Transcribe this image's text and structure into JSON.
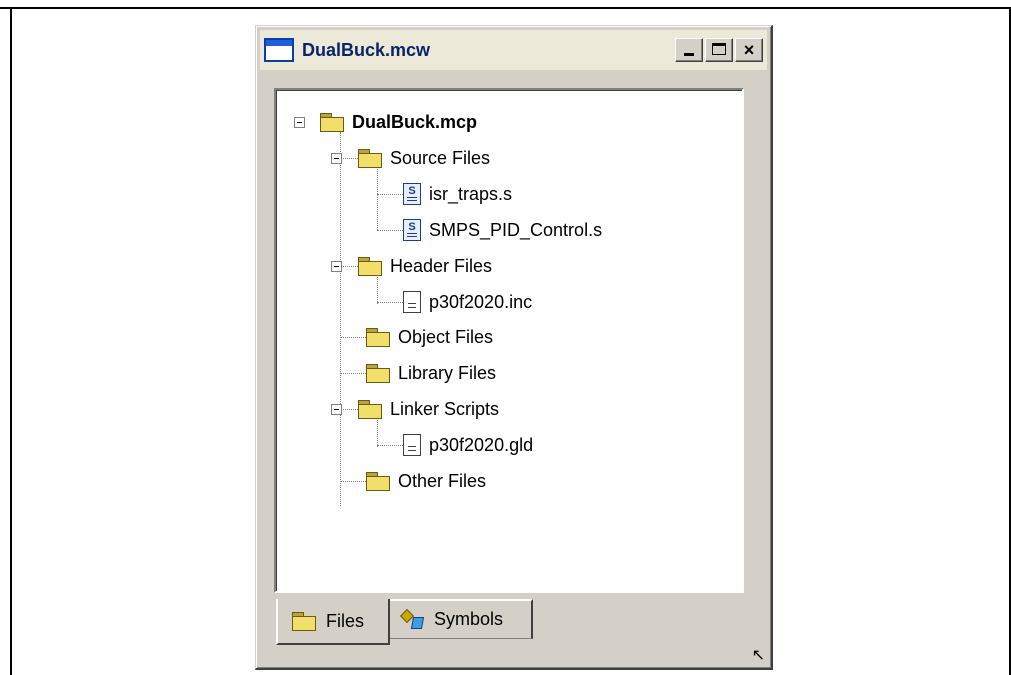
{
  "window": {
    "title": "DualBuck.mcw",
    "controls": {
      "minimize": "minimize",
      "maximize": "maximize",
      "close": "×"
    }
  },
  "tree": {
    "root": {
      "label": "DualBuck.mcp",
      "icon": "folder-icon"
    },
    "groups": [
      {
        "label": "Source Files",
        "children": [
          "isr_traps.s",
          "SMPS_PID_Control.s"
        ]
      },
      {
        "label": "Header Files",
        "children": [
          "p30f2020.inc"
        ]
      },
      {
        "label": "Object Files",
        "children": []
      },
      {
        "label": "Library Files",
        "children": []
      },
      {
        "label": "Linker Scripts",
        "children": [
          "p30f2020.gld"
        ]
      },
      {
        "label": "Other Files",
        "children": []
      }
    ]
  },
  "tabs": [
    {
      "label": "Files",
      "icon": "folder-icon",
      "selected": true
    },
    {
      "label": "Symbols",
      "icon": "symbols-icon",
      "selected": false
    }
  ]
}
